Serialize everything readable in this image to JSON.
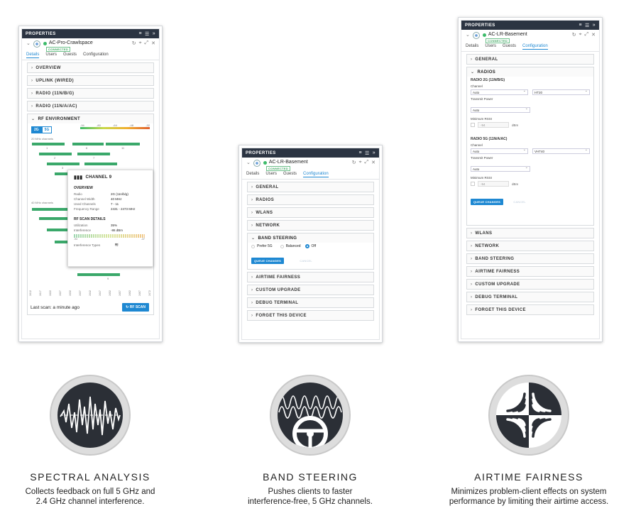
{
  "panel_header": "PROPERTIES",
  "panels": {
    "p1": {
      "device": "AC-Pro-Crawlspace",
      "status": "CONNECTED",
      "tabs": [
        "Details",
        "Users",
        "Guests",
        "Configuration"
      ],
      "sections": [
        "OVERVIEW",
        "UPLINK (WIRED)",
        "RADIO (11N/B/G)",
        "RADIO (11N/A/AC)",
        "RF ENVIRONMENT"
      ],
      "band_tabs": [
        "2G",
        "5G"
      ],
      "scale_ticks": [
        "-94",
        "-80",
        "-64",
        "-48",
        "-32"
      ],
      "label_20mhz": "20 MHz channels",
      "label_40mhz": "40 MHz channels",
      "channel_labels": [
        "1",
        "6",
        "11",
        "2",
        "7",
        "3",
        "9"
      ],
      "tooltip": {
        "title": "CHANNEL 9",
        "overview_title": "OVERVIEW",
        "rows": [
          {
            "k": "Radio",
            "v": "2G (11n/b/g)"
          },
          {
            "k": "Channel Width",
            "v": "40 MHz"
          },
          {
            "k": "Used Channels",
            "v": "7 - 11"
          },
          {
            "k": "Frequency Range",
            "v": "2431 - 2473 MHz"
          }
        ],
        "scan_title": "RF SCAN DETAILS",
        "scan_rows": [
          {
            "k": "Utilization",
            "v": "35%"
          },
          {
            "k": "Interference",
            "v": "-86 dBm"
          }
        ],
        "bar_min": "-94",
        "bar_max": "-37",
        "types_label": "Interference Types"
      },
      "freq_ticks": [
        "2412",
        "2417",
        "2422",
        "2427",
        "2432",
        "2437",
        "2442",
        "2447",
        "2452",
        "2457",
        "2462",
        "2467",
        "2472"
      ],
      "last_scan": "Last scan: a minute ago",
      "rf_scan_button": "RF SCAN"
    },
    "p2": {
      "device": "AC-LR-Basement",
      "status": "CONNECTED",
      "tabs": [
        "Details",
        "Users",
        "Guests",
        "Configuration"
      ],
      "sections_top": [
        "GENERAL",
        "RADIOS",
        "WLANS",
        "NETWORK"
      ],
      "band_steering": "BAND STEERING",
      "options": [
        "Prefer 5G",
        "Balanced",
        "Off"
      ],
      "queue": "QUEUE CHANGES",
      "cancel": "CANCEL",
      "sections_bottom": [
        "AIRTIME FAIRNESS",
        "CUSTOM UPGRADE",
        "DEBUG TERMINAL",
        "FORGET THIS DEVICE"
      ]
    },
    "p3": {
      "device": "AC-LR-Basement",
      "status": "CONNECTED",
      "tabs": [
        "Details",
        "Users",
        "Guests",
        "Configuration"
      ],
      "general": "GENERAL",
      "radios": "RADIOS",
      "radio2g_title": "RADIO 2G (11N/B/G)",
      "radio5g_title": "RADIO 5G (11N/A/AC)",
      "channel_label": "Channel",
      "tx_label": "Transmit Power",
      "rssi_label": "Minimum RSSI",
      "auto": "Auto",
      "ht20": "HT20",
      "vht40": "VHT40",
      "rssi_value": "-94",
      "dbm": "dBm",
      "queue": "QUEUE CHANGES",
      "cancel": "CANCEL",
      "sections_bottom": [
        "WLANS",
        "NETWORK",
        "BAND STEERING",
        "AIRTIME FAIRNESS",
        "CUSTOM UPGRADE",
        "DEBUG TERMINAL",
        "FORGET THIS DEVICE"
      ]
    }
  },
  "features": [
    {
      "title": "SPECTRAL ANALYSIS",
      "line1": "Collects feedback on full 5 GHz and",
      "line2": "2.4 GHz channel interference."
    },
    {
      "title": "BAND STEERING",
      "line1": "Pushes clients to faster",
      "line2": "interference-free, 5 GHz channels."
    },
    {
      "title": "AIRTIME FAIRNESS",
      "line1": "Minimizes problem-client effects on system",
      "line2": "performance by limiting their airtime access."
    }
  ],
  "colors": {
    "accent": "#1e88d2",
    "header": "#2b3442",
    "green": "#3dbb6a"
  }
}
